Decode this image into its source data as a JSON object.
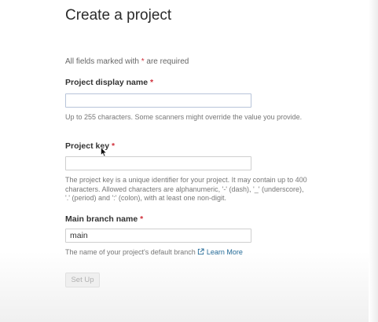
{
  "page": {
    "title": "Create a project",
    "required_note_prefix": "All fields marked with",
    "required_star": "*",
    "required_note_suffix": "are required"
  },
  "fields": {
    "display_name": {
      "label": "Project display name",
      "required_star": "*",
      "value": "",
      "help": "Up to 255 characters. Some scanners might override the value you provide."
    },
    "project_key": {
      "label": "Project key",
      "required_star": "*",
      "value": "",
      "help": "The project key is a unique identifier for your project. It may contain up to 400 characters. Allowed characters are alphanumeric, '-' (dash), '_' (underscore), '.' (period) and ':' (colon), with at least one non-digit."
    },
    "main_branch": {
      "label": "Main branch name",
      "required_star": "*",
      "value": "main",
      "help": "The name of your project's default branch",
      "link_text": "Learn More"
    }
  },
  "actions": {
    "setup_label": "Set Up",
    "setup_disabled": true
  },
  "colors": {
    "required_star": "#d02f3a",
    "link": "#236a97",
    "input_border_focus": "#b7c4d9"
  },
  "icons": [
    "external-link-icon",
    "mouse-cursor-icon"
  ]
}
